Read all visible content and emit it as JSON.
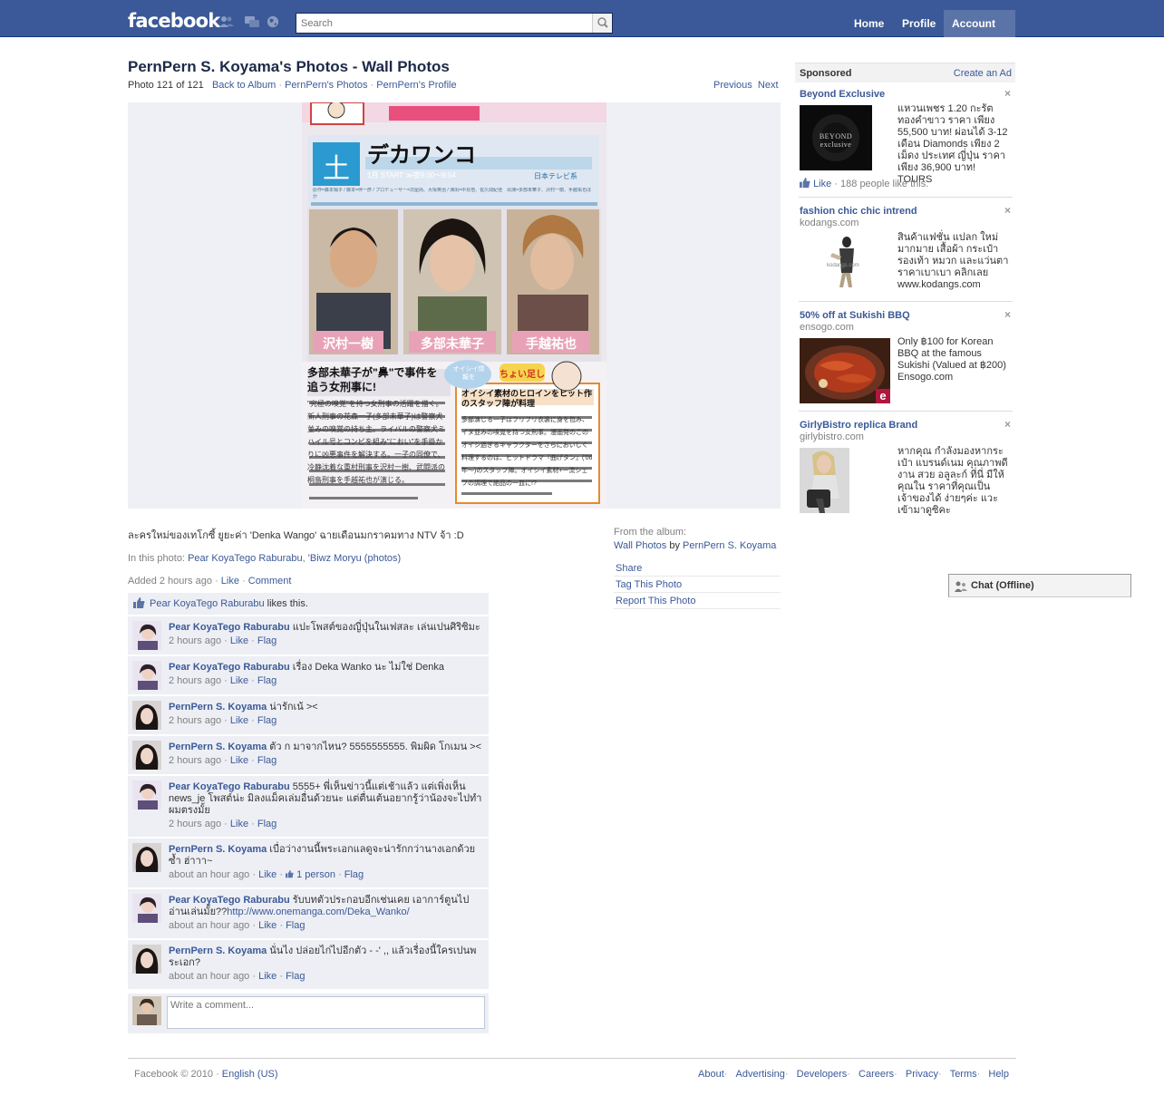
{
  "topbar": {
    "logo": "facebook",
    "search_placeholder": "Search",
    "nav": {
      "home": "Home",
      "profile": "Profile",
      "account": "Account"
    }
  },
  "header": {
    "title": "PernPern S. Koyama's Photos - Wall Photos",
    "photo_position": "Photo 121 of 121",
    "back_to_album": "Back to Album",
    "owners_photos": "PernPern's Photos",
    "owners_profile": "PernPern's Profile",
    "separator": "·",
    "previous": "Previous",
    "next": "Next"
  },
  "photo": {
    "badge": "土",
    "show_title": "デカワンコ",
    "start_line": "1月 START ≫夜9:00〜9:54",
    "network": "日本テレビ系",
    "credits": "原作=森本梢子 / 脚本=伴一彦 / プロデューサー=次屋尚、大塚英治 / 演出=中島悟、佐久間紀佳　出演=多部未華子、沢村一樹、手越祐也ほか",
    "cast": [
      "沢村一樹",
      "多部未華子",
      "手越祐也"
    ],
    "headline": "多部未華子が\"鼻\"で事件を追う女刑事に!",
    "body": "\"究極の嗅覚\"を持つ女刑事の活躍を描く。新人刑事の花森一子(多部未華子)は警察犬並みの嗅覚の持ち主。ライバルの警察犬ミハイル号とコンビを組み\"におい\"を手掛かりに凶悪事件を解決する。一子の同僚で、冷静沈着な重村刑事を沢村一樹、武闘派の桐島刑事を手越祐也が演じる。",
    "bubble": "オイシイ情報を",
    "tasty": "ちょい足し",
    "box_title": "オイシイ素材のヒロインをヒット作のスタッフ陣が料理",
    "box_body": "多部演じる一子はフリフリ衣装に身を包み、イヌ並みの嗅覚を持つ女刑事。漫画発のこのオイシ過ぎるキャラクターをさらにおいしく料理するのは、ヒットドラマ『曲げタン』('06年〜)のスタッフ陣。オイシイ素材+一流シェフの調理で絶品の一皿に!?"
  },
  "caption": "ละครใหม่ของเทโกซี้ ยูยะค่า 'Denka Wango' ฉายเดือนมกราคมทาง NTV จ้า :D",
  "in_this_photo": {
    "label": "In this photo:",
    "person1": "Pear KoyaTego Raburabu",
    "sep": ",",
    "person2": "'Biwz Moryu",
    "photos_link": "photos"
  },
  "added": {
    "time": "Added 2 hours ago",
    "like": "Like",
    "comment": "Comment"
  },
  "from_album": {
    "label": "From the album:",
    "album": "Wall Photos",
    "by": "by",
    "owner": "PernPern S. Koyama"
  },
  "actions": [
    "Share",
    "Tag This Photo",
    "Report This Photo"
  ],
  "likes": {
    "name": "Pear KoyaTego Raburabu",
    "suffix": "likes this."
  },
  "comments": [
    {
      "author": "Pear KoyaTego Raburabu",
      "text": "แปะโพสต์ของญี่ปุ่นในเฟสละ เล่นเปนศิริซิมะ",
      "time": "2 hours ago",
      "like": "Like",
      "flag": "Flag"
    },
    {
      "author": "Pear KoyaTego Raburabu",
      "text": "เรื่อง Deka Wanko นะ ไม่ใช่ Denka",
      "time": "2 hours ago",
      "like": "Like",
      "flag": "Flag"
    },
    {
      "author": "PernPern S. Koyama",
      "text": "น่ารักเน้ ><",
      "time": "2 hours ago",
      "like": "Like",
      "flag": "Flag"
    },
    {
      "author": "PernPern S. Koyama",
      "text": "ตัว ก มาจากไหน? 5555555555. พิมผิด โกเมน ><",
      "time": "2 hours ago",
      "like": "Like",
      "flag": "Flag"
    },
    {
      "author": "Pear KoyaTego Raburabu",
      "text": "5555+ พี่เห็นข่าวนี้แต่เช้าแล้ว แต่เพิ่งเห็น news_je โพสต์น่ะ มิลงแม็คเล่มอื่นด้วยนะ แต่ตื่นเต้นอยากรู้ว่าน้องจะไปทำผมตรงมั้ย",
      "time": "2 hours ago",
      "like": "Like",
      "flag": "Flag"
    },
    {
      "author": "PernPern S. Koyama",
      "text": "เบื่อว่างานนี้พระเอกแลดูจะน่ารักกว่านางเอกด้วยซ้ำ ฮ่าาา~",
      "time": "about an hour ago",
      "like": "Like",
      "likes_count": "1 person",
      "flag": "Flag"
    },
    {
      "author": "Pear KoyaTego Raburabu",
      "text": "รับบทตัวประกอบอีกเช่นเคย เอาการ์ตูนไปอ่านเล่นมั้ย??",
      "link": "http://www.onemanga.com/Deka_Wanko/",
      "time": "about an hour ago",
      "like": "Like",
      "flag": "Flag"
    },
    {
      "author": "PernPern S. Koyama",
      "text": "นั่นไง ปล่อยไก่ไปอีกตัว - -' ,, แล้วเรื่องนี้ใครเปนพระเอก?",
      "time": "about an hour ago",
      "like": "Like",
      "flag": "Flag"
    }
  ],
  "comment_placeholder": "Write a comment...",
  "sidebar": {
    "sponsored": "Sponsored",
    "create_ad": "Create an Ad",
    "close": "×",
    "ads": [
      {
        "title": "Beyond Exclusive",
        "domain": "",
        "image_text": "BEYOND exclusive",
        "text": "แหวนเพชร 1.20 กะรัต ทองคำขาว ราคา เพียง 55,500 บาท! ผ่อนได้ 3-12 เดือน Diamonds เพียง 2 เม็ดง ประเทศ ญี่ปุ่น ราคา เพียง 36,900 บาท! TOURS",
        "like": "Like",
        "like_count": "· 188 people like this."
      },
      {
        "title": "fashion chic chic intrend",
        "domain": "kodangs.com",
        "image_text": "kodangs.com",
        "text": "สินค้าแฟชั่น แปลก ใหม่ มากมาย เสื้อผ้า กระเป๋า รองเท้า หมวก และแว่นตา ราคาเบาเบา คลิกเลย www.kodangs.com"
      },
      {
        "title": "50% off at Sukishi BBQ",
        "domain": "ensogo.com",
        "image_text": "e",
        "text": "Only ฿100 for Korean BBQ at the famous Sukishi (Valued at ฿200) Ensogo.com"
      },
      {
        "title": "GirlyBistro replica Brand",
        "domain": "girlybistro.com",
        "text": "หากคุณ กำลังมองหากระเป๋า แบรนด์เนม คุณภาพดี งาน สวย อลูละก์ ที่นี่ มีให้คุณใน ราคาที่คุณเป็นเจ้าของได้ ง่ายๆค่ะ แวะเข้ามาดูซิคะ"
      }
    ]
  },
  "chat": {
    "label": "Chat (Offline)"
  },
  "footer": {
    "copyright": "Facebook © 2010",
    "sep": "·",
    "language": "English (US)",
    "links": [
      "About",
      "Advertising",
      "Developers",
      "Careers",
      "Privacy",
      "Terms",
      "Help"
    ]
  },
  "colors": {
    "brand": "#3b5998",
    "brand_dark": "#133783",
    "comment_bg": "#edeff4",
    "link": "#3b5998",
    "muted": "#808080"
  }
}
